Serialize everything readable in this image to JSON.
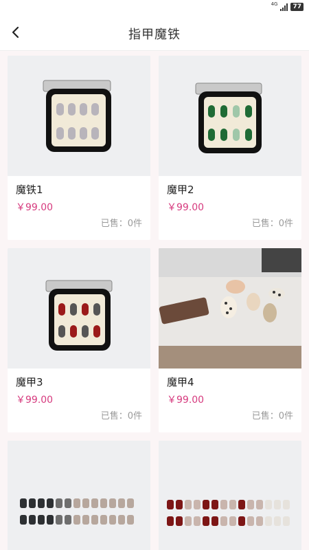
{
  "statusbar": {
    "network": "4G",
    "battery": "77"
  },
  "navbar": {
    "title": "指甲魔铁"
  },
  "products": [
    {
      "name": "魔铁1",
      "price": "￥99.00",
      "sold": "已售：0件"
    },
    {
      "name": "魔甲2",
      "price": "￥99.00",
      "sold": "已售：0件"
    },
    {
      "name": "魔甲3",
      "price": "￥99.00",
      "sold": "已售：0件"
    },
    {
      "name": "魔甲4",
      "price": "￥99.00",
      "sold": "已售：0件"
    }
  ],
  "colors": {
    "price": "#d63a7e",
    "background": "#fbf5f6"
  }
}
